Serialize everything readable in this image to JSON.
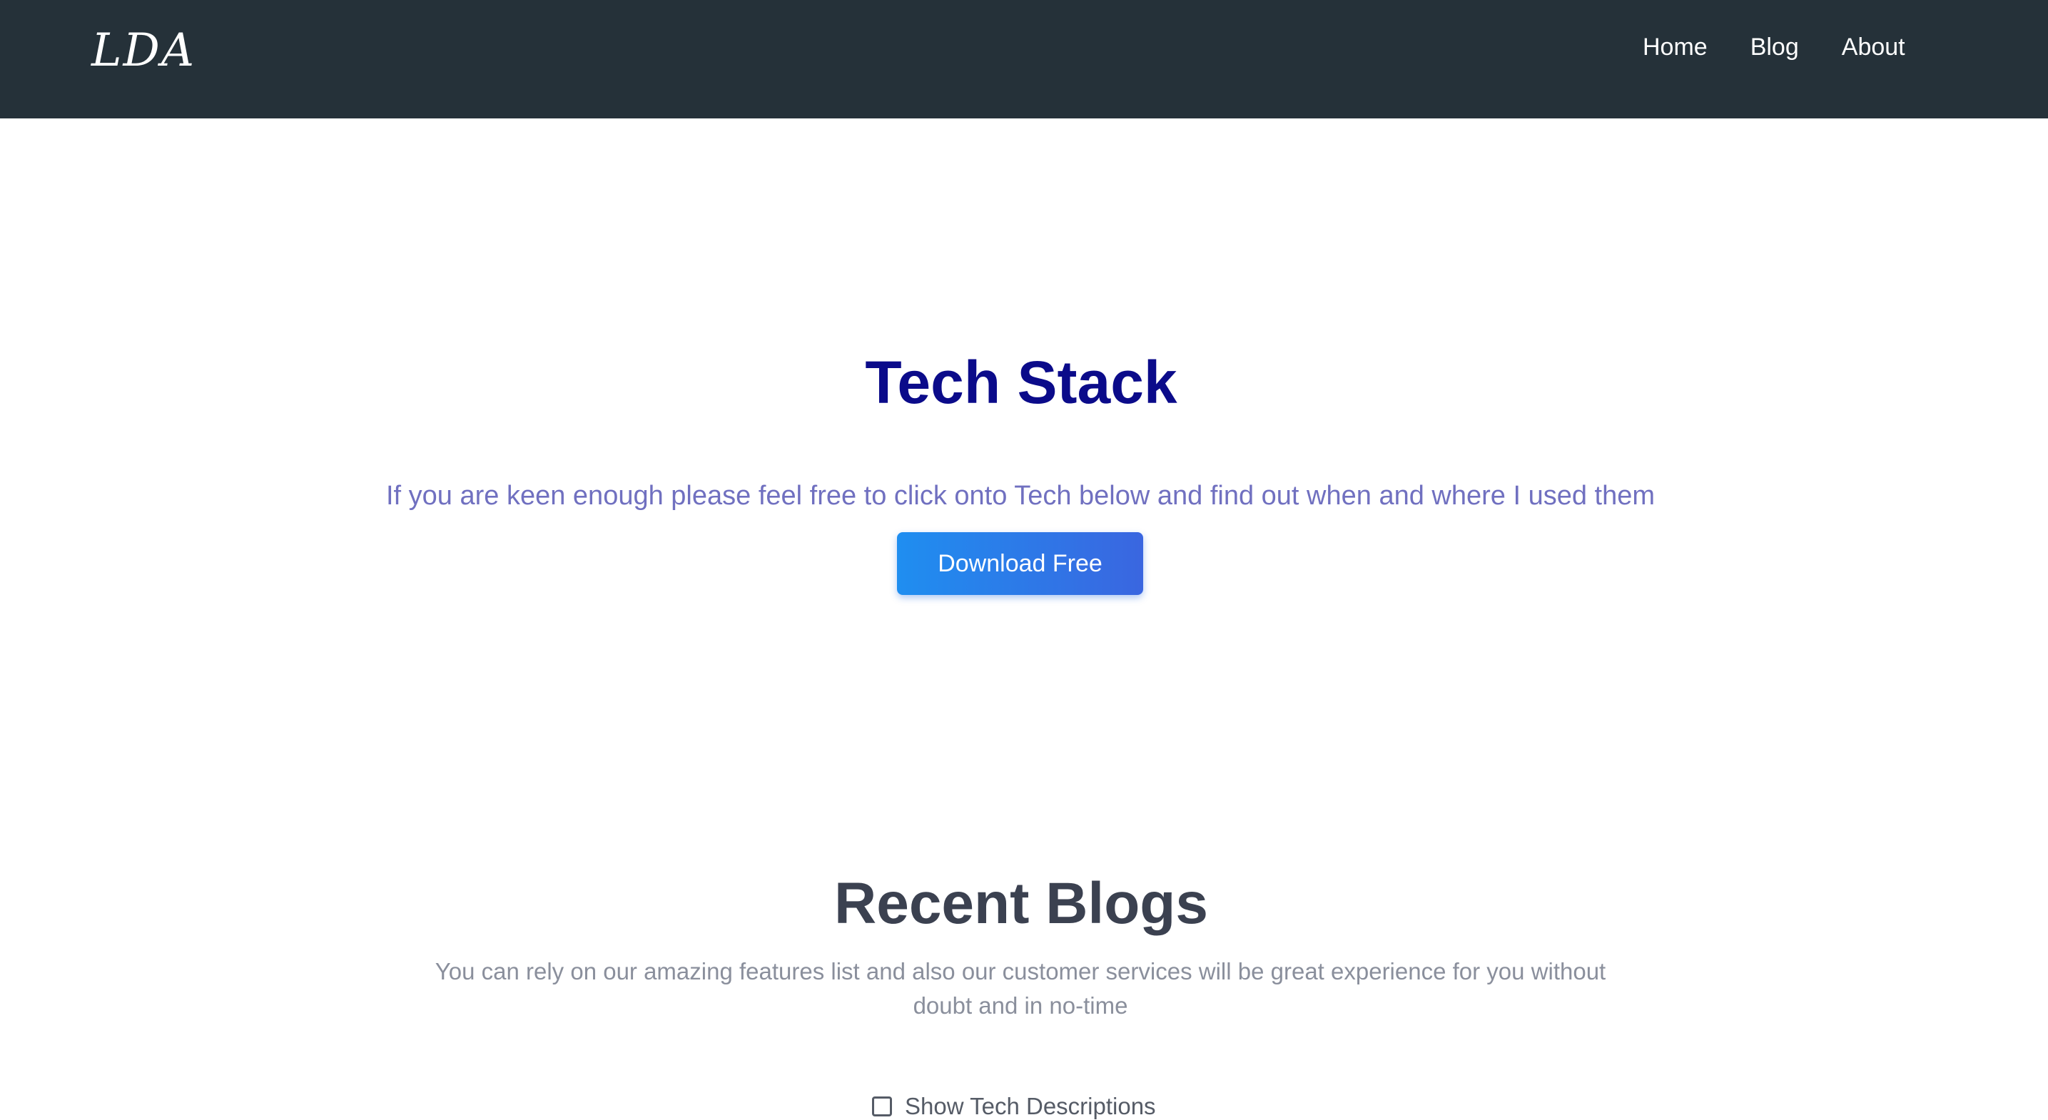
{
  "nav": {
    "logo": "LDA",
    "links": [
      "Home",
      "Blog",
      "About"
    ]
  },
  "hero": {
    "title": "Tech Stack",
    "subtitle": "If you are keen enough please feel free to click onto Tech below and find out when and where I used them",
    "button_label": "Download Free"
  },
  "blogs": {
    "title": "Recent Blogs",
    "description": "You can rely on our amazing features list and also our customer services will be great experience for you without doubt and in no-time",
    "checkbox_label": "Show Tech Descriptions"
  },
  "colors": {
    "navbar_bg": "#253139",
    "hero_title": "#0b0b8a",
    "hero_subtitle": "#7070c0",
    "button_start": "#1f8ef0",
    "button_end": "#3a66e0",
    "section_title": "#3b4150",
    "section_desc": "#8a8f9c"
  }
}
